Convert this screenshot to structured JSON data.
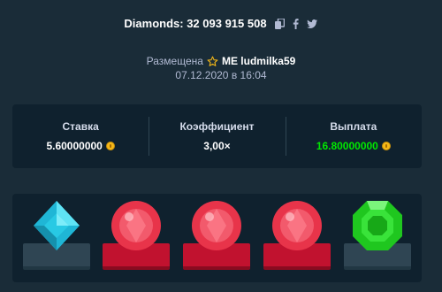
{
  "header": {
    "title": "Diamonds: 32 093 915 508",
    "icons": [
      "copy-icon",
      "facebook-icon",
      "twitter-icon"
    ]
  },
  "meta": {
    "placed_label": "Размещена",
    "user": "ME ludmilka59",
    "datetime": "07.12.2020 в 16:04"
  },
  "stats": {
    "bet_label": "Ставка",
    "bet_value": "5.60000000",
    "multiplier_label": "Коэффициент",
    "multiplier_value": "3,00×",
    "payout_label": "Выплата",
    "payout_value": "16.80000000"
  },
  "colors": {
    "background": "#1a2c38",
    "panel": "#0f212e",
    "win_green": "#00e701",
    "highlight_red": "#c1122f",
    "coin": "#f5b818"
  },
  "gems": [
    {
      "type": "cyan-diamond",
      "highlighted": false
    },
    {
      "type": "red-round-gem",
      "highlighted": true
    },
    {
      "type": "red-round-gem",
      "highlighted": true
    },
    {
      "type": "red-round-gem",
      "highlighted": true
    },
    {
      "type": "green-emerald",
      "highlighted": false
    }
  ]
}
